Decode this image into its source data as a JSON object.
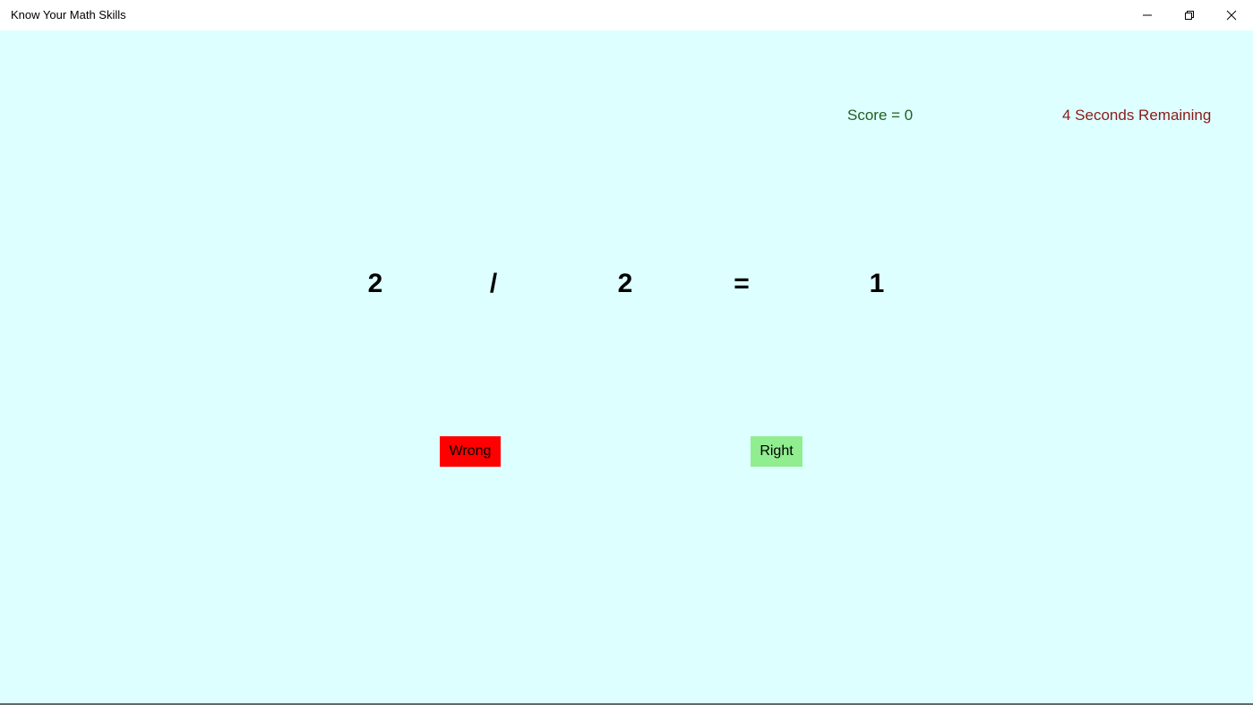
{
  "window": {
    "title": "Know Your Math Skills",
    "controls": [
      "minimize-icon",
      "restore-icon",
      "close-icon"
    ]
  },
  "status": {
    "score_text": "Score = 0",
    "timer_text": "4 Seconds Remaining",
    "score_color": "#1f5f1f",
    "timer_color": "#8b1a1a"
  },
  "equation": {
    "operand1": "2",
    "operator": "/",
    "operand2": "2",
    "equals": "=",
    "result": "1"
  },
  "buttons": {
    "wrong_label": "Wrong",
    "right_label": "Right",
    "wrong_color": "#FF0000",
    "right_color": "#90EE90"
  },
  "colors": {
    "background": "#DEFFFF",
    "titlebar": "#FFFFFF"
  }
}
